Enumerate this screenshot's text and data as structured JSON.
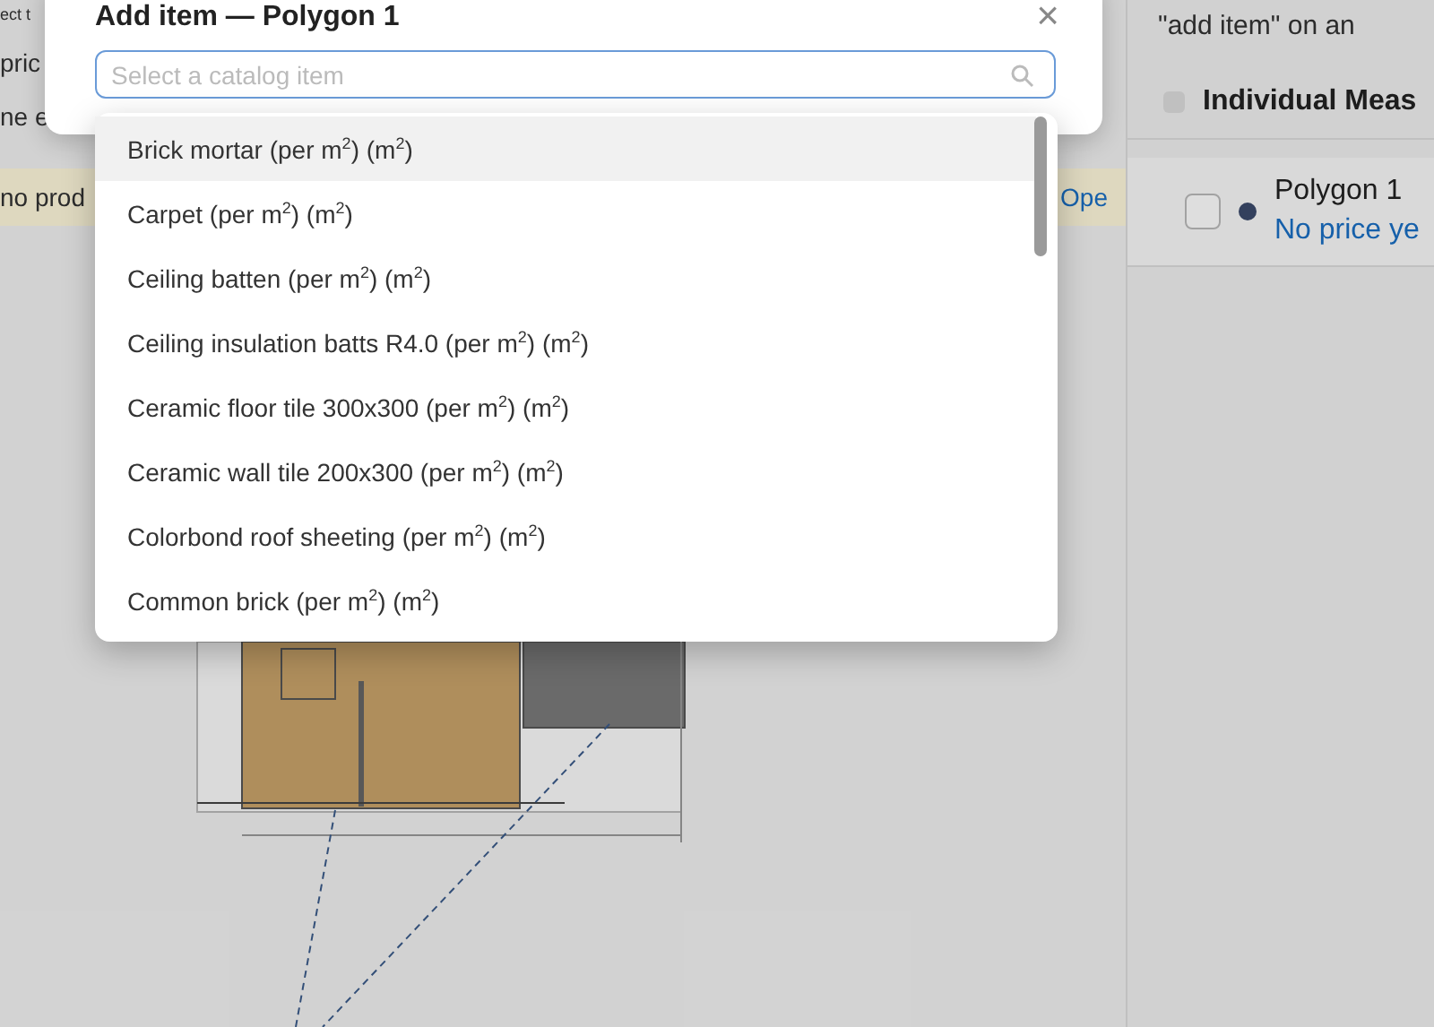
{
  "background": {
    "left_texts": [
      {
        "kind": "hint",
        "text": "ect t"
      },
      {
        "kind": "line",
        "text": "pric"
      },
      {
        "kind": "line",
        "text": "ne e"
      }
    ],
    "notice": {
      "text": "no prod",
      "link": "Ope"
    },
    "side_panel": {
      "hint": "\"add item\" on an",
      "section_title": "Individual Meas",
      "select_all_checked": false,
      "measurement": {
        "name": "Polygon 1",
        "price": "No price ye",
        "checked": false,
        "color": "#3b4a6b"
      }
    }
  },
  "dialog": {
    "title": "Add item — Polygon 1",
    "close": "×",
    "search": {
      "placeholder": "Select a catalog item"
    },
    "options": [
      {
        "label": "Brick mortar (per m$^{2}$) (m$^{2}$)",
        "selected": true
      },
      {
        "label": "Carpet (per m$^{2}$) (m$^{2}$)",
        "selected": false
      },
      {
        "label": "Ceiling batten (per m$^{2}$) (m$^{2}$)",
        "selected": false
      },
      {
        "label": "Ceiling insulation batts R4.0 (per m$^{2}$) (m$^{2}$)",
        "selected": false
      },
      {
        "label": "Ceramic floor tile 300x300 (per m$^{2}$) (m$^{2}$)",
        "selected": false
      },
      {
        "label": "Ceramic wall tile 200x300 (per m$^{2}$) (m$^{2}$)",
        "selected": false
      },
      {
        "label": "Colorbond roof sheeting (per m$^{2}$) (m$^{2}$)",
        "selected": false
      },
      {
        "label": "Common brick (per m$^{2}$) (m$^{2}$)",
        "selected": false
      }
    ]
  }
}
